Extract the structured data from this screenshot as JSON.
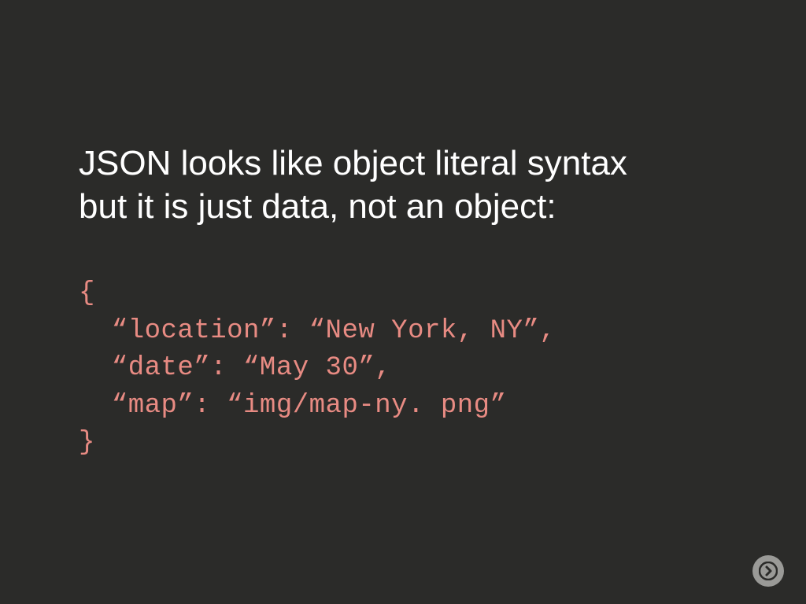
{
  "heading_line1": "JSON looks like object literal syntax",
  "heading_line2": "but it is just data, not an object:",
  "code": {
    "open": "{",
    "line1": "  “location”: “New York, NY”,",
    "line2": "  “date”: “May 30”,",
    "line3": "  “map”: “img/map-ny. png”",
    "close": "}"
  }
}
